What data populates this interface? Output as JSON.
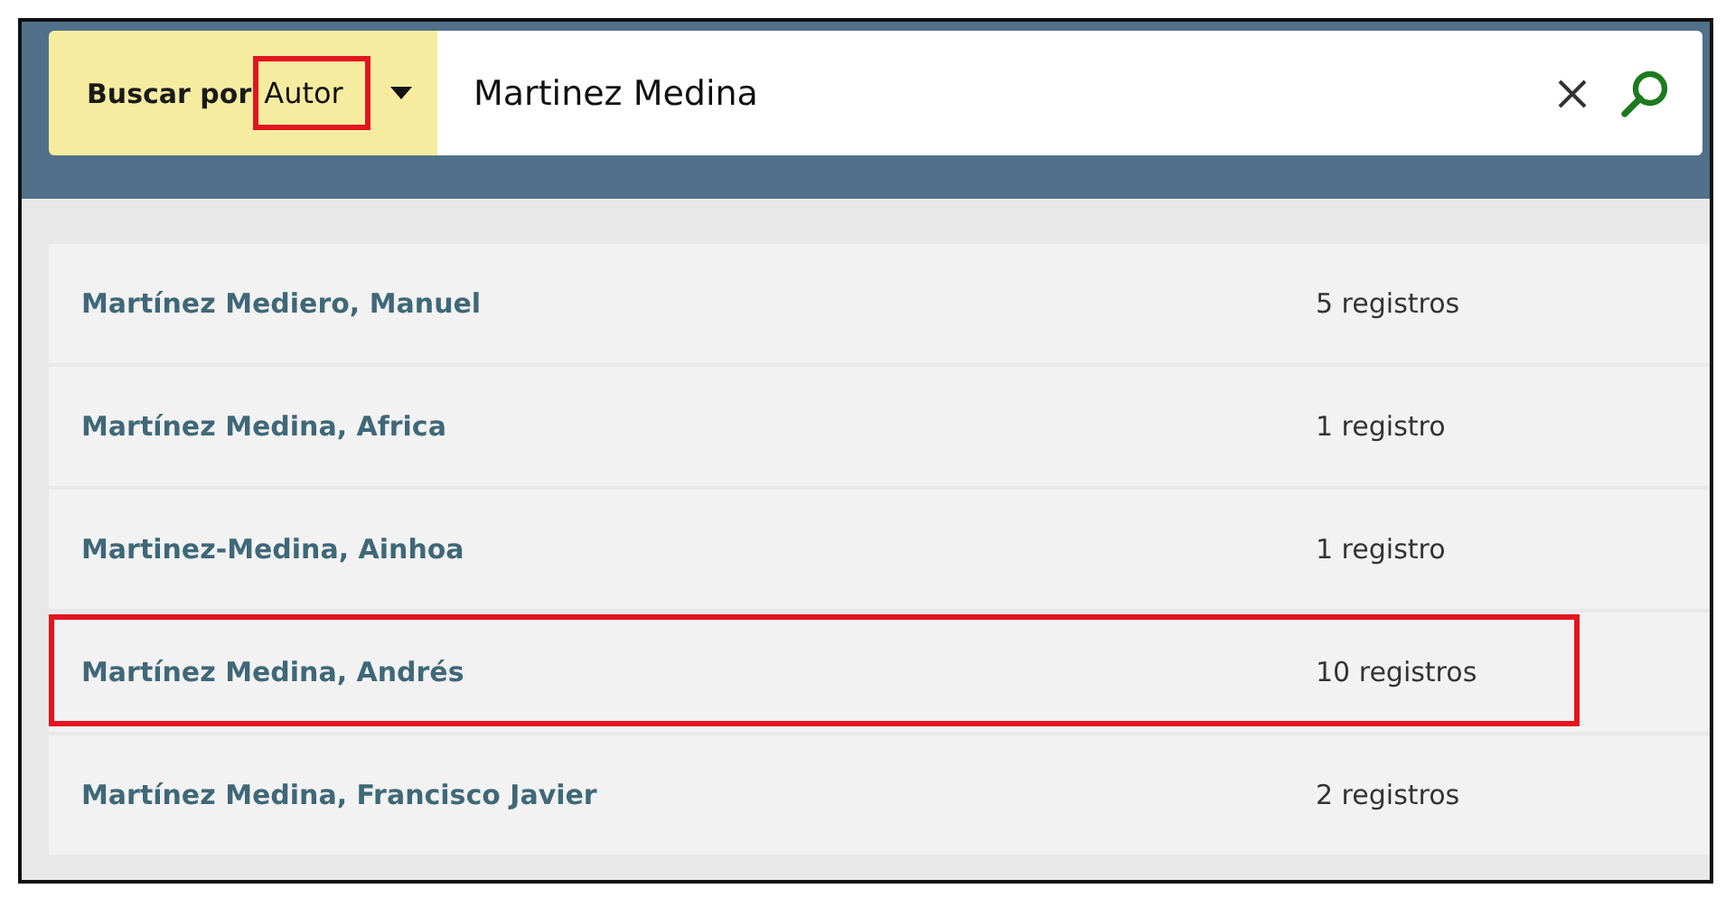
{
  "search": {
    "label": "Buscar por",
    "field_type": {
      "value": "Autor",
      "highlighted": true
    },
    "query": "Martinez Medina"
  },
  "results": [
    {
      "name": "Martínez Mediero, Manuel",
      "count": "5 registros",
      "highlighted": false
    },
    {
      "name": "Martínez Medina, Africa",
      "count": "1 registro",
      "highlighted": false
    },
    {
      "name": "Martinez-Medina, Ainhoa",
      "count": "1 registro",
      "highlighted": false
    },
    {
      "name": "Martínez Medina, Andrés",
      "count": "10 registros",
      "highlighted": true
    },
    {
      "name": "Martínez Medina, Francisco Javier",
      "count": "2 registros",
      "highlighted": false
    }
  ]
}
